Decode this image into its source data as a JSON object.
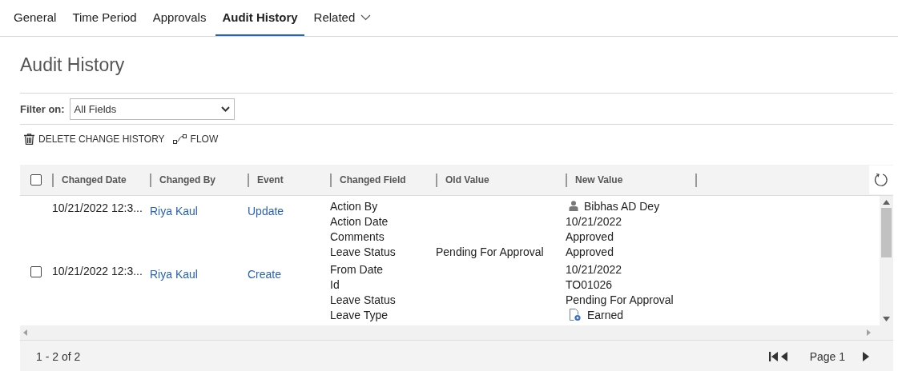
{
  "tabs": [
    {
      "label": "General",
      "selected": false
    },
    {
      "label": "Time Period",
      "selected": false
    },
    {
      "label": "Approvals",
      "selected": false
    },
    {
      "label": "Audit History",
      "selected": true
    },
    {
      "label": "Related",
      "selected": false,
      "kind": "dropdown"
    }
  ],
  "title": "Audit History",
  "filter": {
    "label": "Filter on:",
    "value": "All Fields"
  },
  "toolbar": [
    {
      "kind": "delete",
      "label": "DELETE CHANGE HISTORY"
    },
    {
      "kind": "flow",
      "label": "FLOW"
    }
  ],
  "grid": {
    "select_all_checked": false,
    "columns": [
      "Changed Date",
      "Changed By",
      "Event",
      "Changed Field",
      "Old Value",
      "New Value"
    ],
    "records": [
      {
        "selectable": false,
        "changed_date": "10/21/2022 12:3...",
        "changed_by": "Riya Kaul",
        "event": "Update",
        "fields": [
          {
            "field": "Action By",
            "new_value": "Bibhas AD Dey",
            "kind": "user"
          },
          {
            "field": "Action Date",
            "new_value": "10/21/2022",
            "kind": "text"
          },
          {
            "field": "Comments",
            "new_value": "Approved",
            "kind": "text"
          },
          {
            "field": "Leave Status",
            "old_value": "Pending For Approval",
            "new_value": "Approved",
            "kind": "text"
          }
        ]
      },
      {
        "selectable": true,
        "checked": false,
        "changed_date": "10/21/2022 12:3...",
        "changed_by": "Riya Kaul",
        "event": "Create",
        "fields": [
          {
            "field": "From Date",
            "new_value": "10/21/2022",
            "kind": "text"
          },
          {
            "field": "Id",
            "new_value": "TO01026",
            "kind": "text"
          },
          {
            "field": "Leave Status",
            "new_value": "Pending For Approval",
            "kind": "text"
          },
          {
            "field": "Leave Type",
            "new_value": "Earned",
            "kind": "record"
          }
        ]
      }
    ],
    "record_count": "1 - 2 of 2",
    "page": "Page 1"
  }
}
